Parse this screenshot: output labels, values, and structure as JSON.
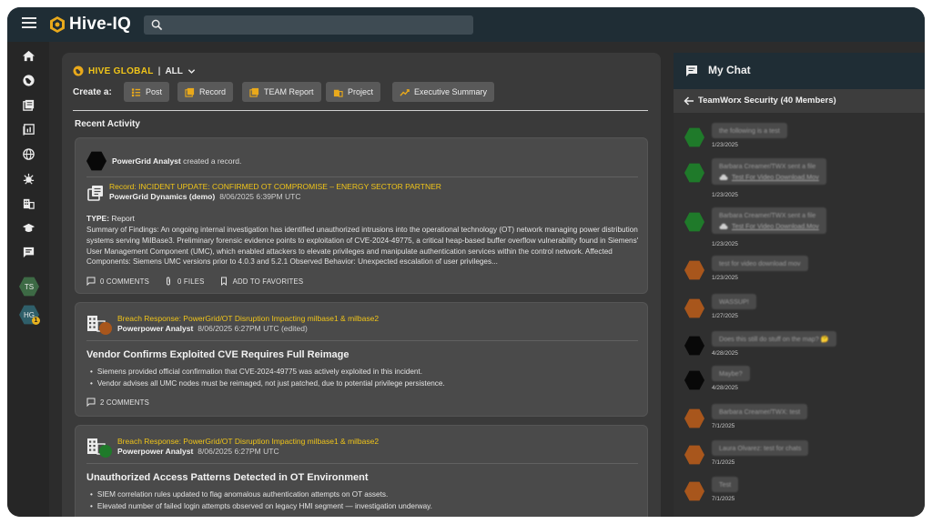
{
  "app": {
    "logo_text": "Hive-IQ"
  },
  "search": {
    "placeholder": ""
  },
  "rail": {
    "avatars": [
      {
        "initials": "TS"
      },
      {
        "initials": "HG",
        "badge": "1"
      }
    ]
  },
  "feed": {
    "scope_name": "HIVE GLOBAL",
    "scope_sep": "|",
    "scope_filter": "ALL",
    "create_label": "Create a:",
    "create_buttons": [
      "Post",
      "Record",
      "TEAM Report",
      "Project",
      "Executive Summary"
    ],
    "recent_label": "Recent Activity",
    "cards": [
      {
        "actor": "PowerGrid Analyst",
        "action": "created a record.",
        "record_title": "Record: INCIDENT UPDATE: CONFIRMED OT COMPROMISE – ENERGY SECTOR PARTNER",
        "org": "PowerGrid Dynamics (demo)",
        "date": "8/06/2025 6:39PM UTC",
        "type_label": "TYPE:",
        "type_value": "Report",
        "summary": "Summary of Findings: An ongoing internal investigation has identified unauthorized intrusions into the operational technology (OT) network managing power distribution systems serving MilBase3. Preliminary forensic evidence points to exploitation of CVE-2024-49775, a critical heap-based buffer overflow vulnerability found in Siemens' User Management Component (UMC), which enabled attackers to elevate privileges and manipulate authentication services within the control network. Affected Components: Siemens UMC versions prior to 4.0.3 and 5.2.1 Observed Behavior: Unexpected escalation of user privileges...",
        "comments": "0 COMMENTS",
        "files": "0 FILES",
        "favorites": "ADD TO FAVORITES"
      },
      {
        "project": "Breach Response: PowerGrid/OT Disruption Impacting milbase1 & milbase2",
        "author": "Powerpower Analyst",
        "date": "8/06/2025 6:27PM UTC (edited)",
        "title": "Vendor Confirms Exploited CVE Requires Full Reimage",
        "bullets": [
          "Siemens provided official confirmation that CVE-2024-49775 was actively exploited in this incident.",
          "Vendor advises all UMC nodes must be reimaged, not just patched, due to potential privilege persistence."
        ],
        "comments": "2 COMMENTS",
        "dot_color": "#a8561c"
      },
      {
        "project": "Breach Response: PowerGrid/OT Disruption Impacting milbase1 & milbase2",
        "author": "Powerpower Analyst",
        "date": "8/06/2025 6:27PM UTC",
        "title": "Unauthorized Access Patterns Detected in OT Environment",
        "bullets": [
          "SIEM correlation rules updated to flag anomalous authentication attempts on OT assets.",
          "Elevated number of failed login attempts observed on legacy HMI segment — investigation underway."
        ],
        "dot_color": "#1f7a2a"
      }
    ]
  },
  "chat": {
    "title": "My Chat",
    "channel": "TeamWorx Security (40 Members)",
    "messages": [
      {
        "text": "the following is a test",
        "date": "1/23/2025",
        "color": "#1f7a2a"
      },
      {
        "text": "Barbara Creamer/TWX sent a file",
        "file": "Test For Video Download.Mov",
        "date": "1/23/2025",
        "color": "#1f7a2a"
      },
      {
        "text": "Barbara Creamer/TWX sent a file",
        "file": "Test For Video Download.Mov",
        "date": "1/23/2025",
        "color": "#1f7a2a"
      },
      {
        "text": "test for video download mov",
        "date": "1/23/2025",
        "color": "#a8561c"
      },
      {
        "text": "WASSUP!",
        "date": "1/27/2025",
        "color": "#a8561c"
      },
      {
        "text": "Does this still do stuff on the map? 🤔",
        "date": "4/28/2025",
        "color": "#080808"
      },
      {
        "text": "Maybe?",
        "date": "4/28/2025",
        "color": "#080808"
      },
      {
        "text": "Barbara Creamer/TWX: test",
        "date": "7/1/2025",
        "color": "#a8561c"
      },
      {
        "text": "Laura Olvarez: test for chats",
        "date": "7/1/2025",
        "color": "#a8561c"
      },
      {
        "text": "Test",
        "date": "7/1/2025",
        "color": "#a8561c"
      }
    ]
  },
  "colors": {
    "accent": "#f0c419",
    "topbar": "#1f2d35",
    "panel": "#3a3a3a",
    "card": "#4a4a4a"
  }
}
